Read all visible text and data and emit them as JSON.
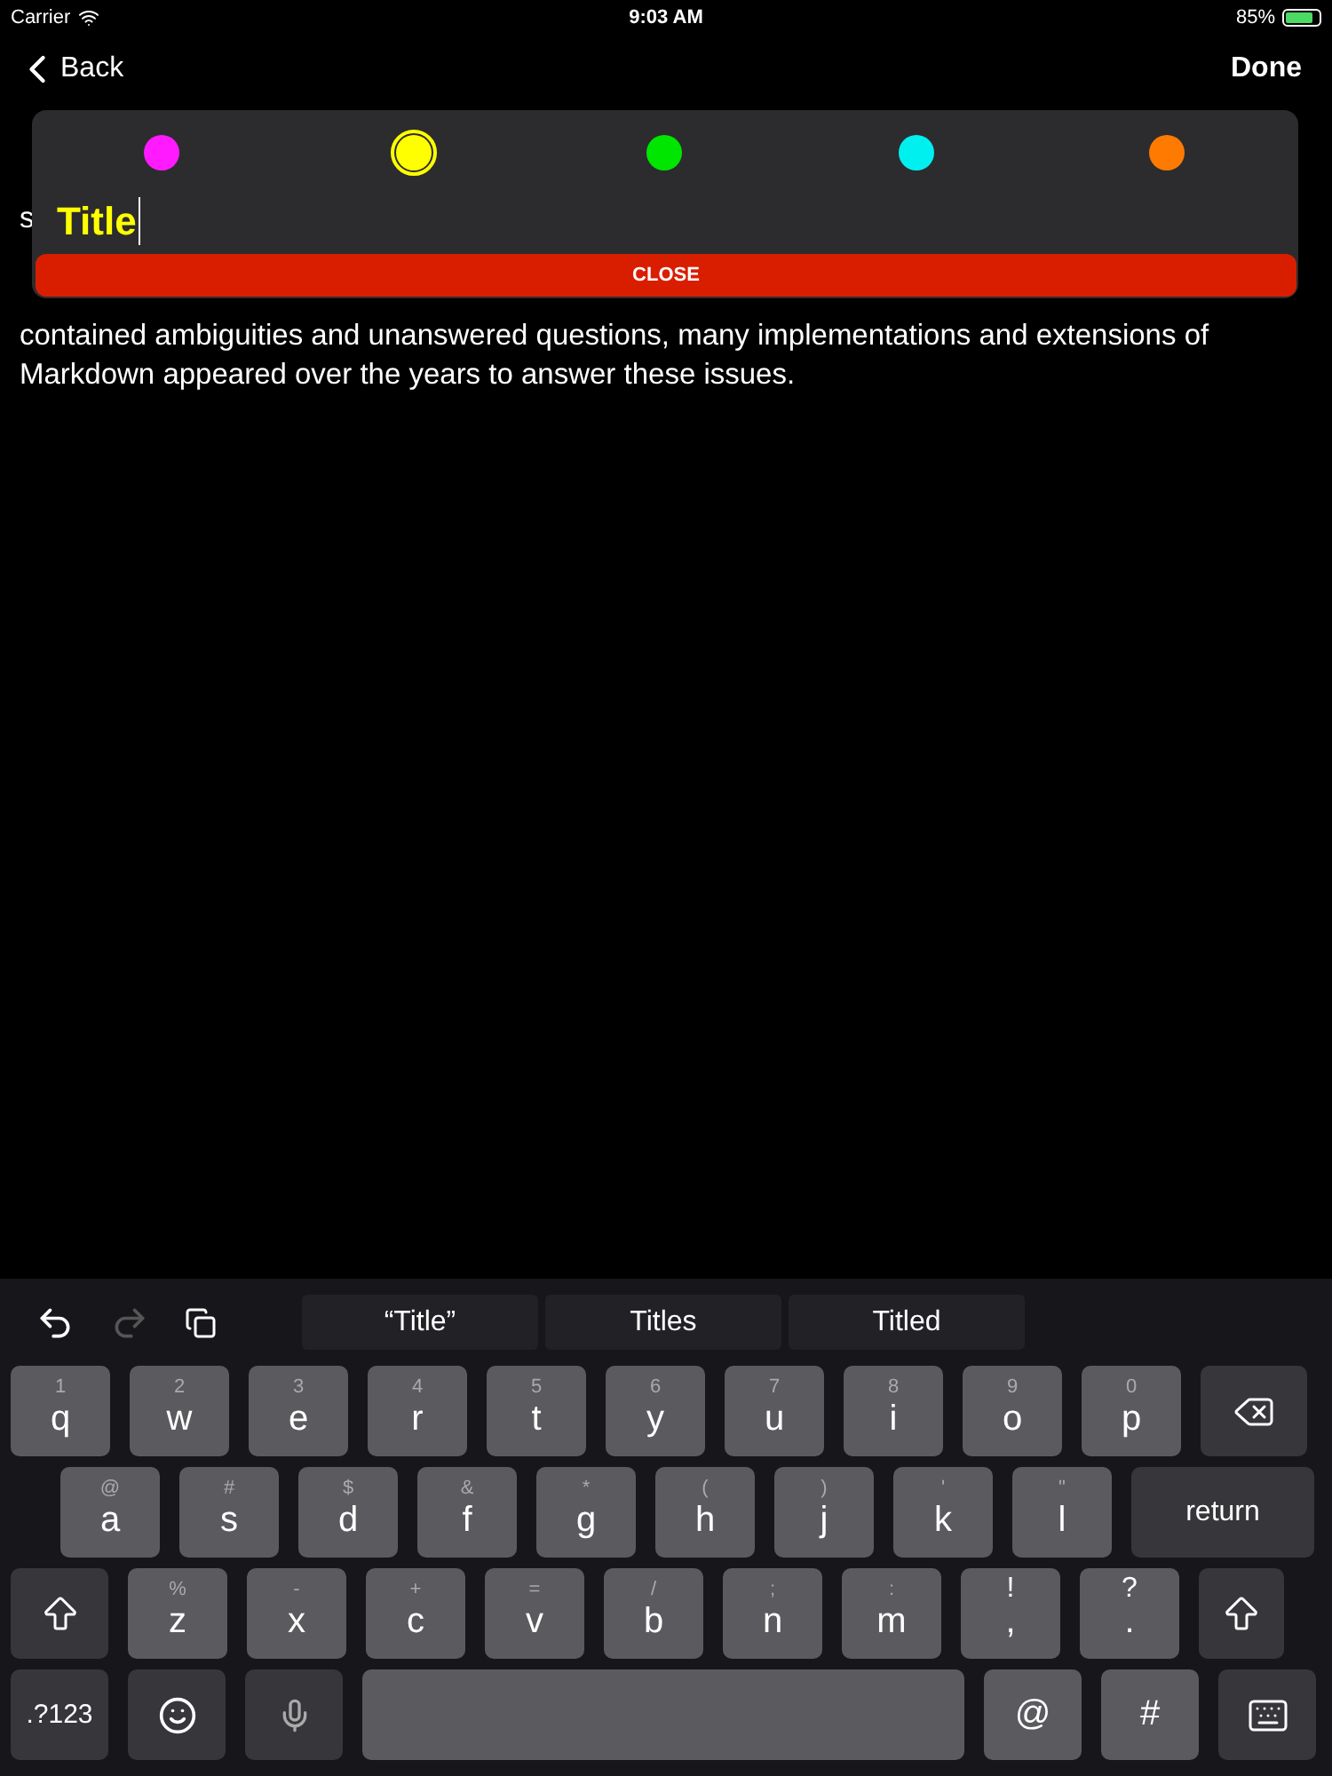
{
  "status_bar": {
    "carrier": "Carrier",
    "time": "9:03 AM",
    "battery": "85%"
  },
  "nav": {
    "back": "Back",
    "done": "Done"
  },
  "body": {
    "covered_lines": [
      "s"
    ],
    "lines": [
      "contained ambiguities and unanswered questions, many implementations and extensions of",
      "Markdown appeared over the years to answer these issues."
    ]
  },
  "popup": {
    "colors": [
      {
        "color": "#ff1aff",
        "selected": false
      },
      {
        "color": "#ffff00",
        "selected": true
      },
      {
        "color": "#00e600",
        "selected": false
      },
      {
        "color": "#00f0f0",
        "selected": false
      },
      {
        "color": "#ff7a00",
        "selected": false
      }
    ],
    "title_value": "Title",
    "close": "CLOSE"
  },
  "keyboard": {
    "suggestions": [
      "“Title”",
      "Titles",
      "Titled"
    ],
    "rows": [
      [
        {
          "kind": "letter",
          "label": "q",
          "hint": "1"
        },
        {
          "kind": "letter",
          "label": "w",
          "hint": "2"
        },
        {
          "kind": "letter",
          "label": "e",
          "hint": "3"
        },
        {
          "kind": "letter",
          "label": "r",
          "hint": "4"
        },
        {
          "kind": "letter",
          "label": "t",
          "hint": "5"
        },
        {
          "kind": "letter",
          "label": "y",
          "hint": "6"
        },
        {
          "kind": "letter",
          "label": "u",
          "hint": "7"
        },
        {
          "kind": "letter",
          "label": "i",
          "hint": "8"
        },
        {
          "kind": "letter",
          "label": "o",
          "hint": "9"
        },
        {
          "kind": "letter",
          "label": "p",
          "hint": "0"
        },
        {
          "kind": "backspace"
        }
      ],
      [
        {
          "kind": "letter",
          "label": "a",
          "hint": "@"
        },
        {
          "kind": "letter",
          "label": "s",
          "hint": "#"
        },
        {
          "kind": "letter",
          "label": "d",
          "hint": "$"
        },
        {
          "kind": "letter",
          "label": "f",
          "hint": "&"
        },
        {
          "kind": "letter",
          "label": "g",
          "hint": "*"
        },
        {
          "kind": "letter",
          "label": "h",
          "hint": "("
        },
        {
          "kind": "letter",
          "label": "j",
          "hint": ")"
        },
        {
          "kind": "letter",
          "label": "k",
          "hint": "'"
        },
        {
          "kind": "letter",
          "label": "l",
          "hint": "\""
        },
        {
          "kind": "return",
          "label": "return"
        }
      ],
      [
        {
          "kind": "shift"
        },
        {
          "kind": "letter",
          "label": "z",
          "hint": "%"
        },
        {
          "kind": "letter",
          "label": "x",
          "hint": "-"
        },
        {
          "kind": "letter",
          "label": "c",
          "hint": "+"
        },
        {
          "kind": "letter",
          "label": "v",
          "hint": "="
        },
        {
          "kind": "letter",
          "label": "b",
          "hint": "/"
        },
        {
          "kind": "letter",
          "label": "n",
          "hint": ";"
        },
        {
          "kind": "letter",
          "label": "m",
          "hint": ":"
        },
        {
          "kind": "punct",
          "label": ",",
          "hint": "!"
        },
        {
          "kind": "punct",
          "label": ".",
          "hint": "?"
        },
        {
          "kind": "shift"
        }
      ],
      [
        {
          "kind": "mode",
          "label": ".?123"
        },
        {
          "kind": "emoji"
        },
        {
          "kind": "mic"
        },
        {
          "kind": "space"
        },
        {
          "kind": "symbol",
          "label": "@"
        },
        {
          "kind": "symbol",
          "label": "#"
        },
        {
          "kind": "hide"
        }
      ]
    ]
  }
}
